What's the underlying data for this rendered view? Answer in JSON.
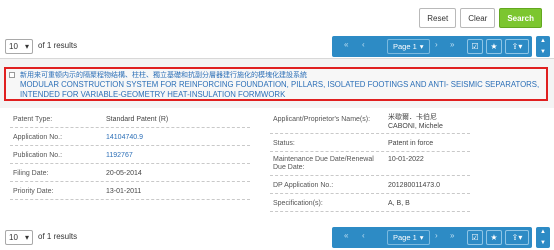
{
  "actions": {
    "reset": "Reset",
    "clear": "Clear",
    "search": "Search"
  },
  "pager": {
    "page_size": "10",
    "results_text": "of 1 results",
    "first": "«",
    "prev": "‹",
    "page_label": "Page 1",
    "next": "›",
    "last": "»"
  },
  "result": {
    "title_chinese": "新用来可重顿内示的隔聚程物结構、柱柱、獨立基礎和抗副分層器建行施化的模塊化建設系統",
    "title_english": "MODULAR CONSTRUCTION SYSTEM FOR REINFORCING FOUNDATION, PILLARS, ISOLATED FOOTINGS AND ANTI- SEISMIC SEPARATORS, INTENDED FOR VARIABLE-GEOMETRY HEAT-INSULATION FORMWORK"
  },
  "details_left": [
    {
      "label": "Patent Type:",
      "value": "Standard Patent (R)",
      "link": false
    },
    {
      "label": "Application No.:",
      "value": "14104740.9",
      "link": true
    },
    {
      "label": "Publication No.:",
      "value": "1192767",
      "link": true
    },
    {
      "label": "Filing Date:",
      "value": "20-05-2014",
      "link": false
    },
    {
      "label": "Priority Date:",
      "value": "13-01-2011",
      "link": false
    }
  ],
  "details_right": [
    {
      "label": "Applicant/Proprietor's Name(s):",
      "value_cn": "米歇爾．卡伯尼",
      "value": "CABONI, Michele"
    },
    {
      "label": "Status:",
      "value": "Patent in force"
    },
    {
      "label": "Maintenance Due Date/Renewal Due Date:",
      "value": "10-01-2022"
    },
    {
      "label": "DP Application No.:",
      "value": "201280011473.0"
    },
    {
      "label": "Specification(s):",
      "value": "A, B, B"
    }
  ],
  "colors": {
    "accent": "#2d8bc5",
    "link": "#2c6fb7",
    "highlight": "#e02020",
    "search": "#7cc62f"
  }
}
